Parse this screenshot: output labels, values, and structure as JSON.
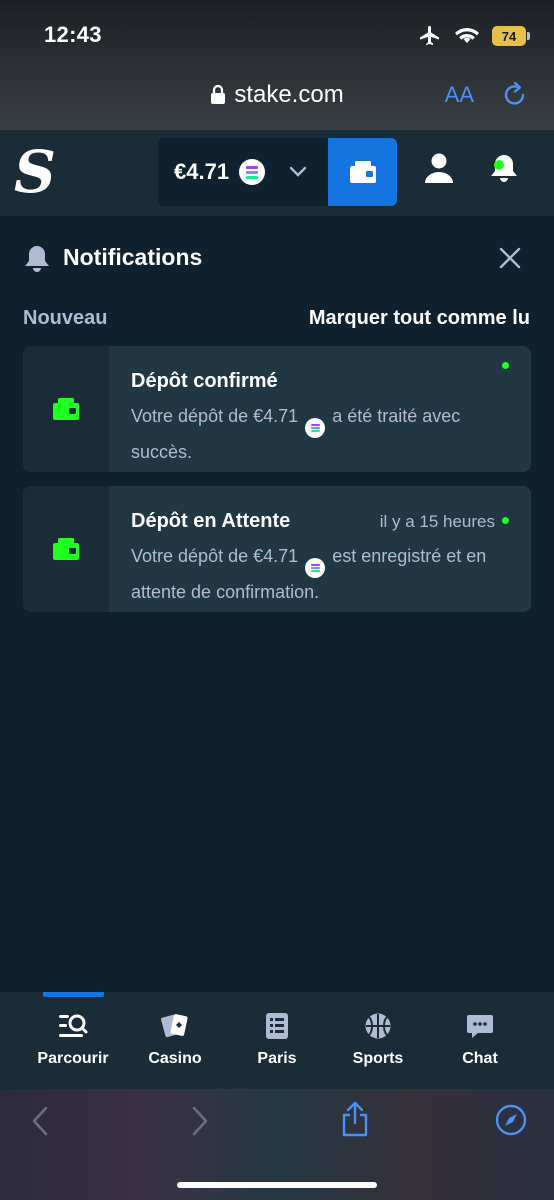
{
  "status_bar": {
    "time": "12:43",
    "battery_level": "74"
  },
  "browser": {
    "url": "stake.com",
    "text_size_label": "AA"
  },
  "header": {
    "logo": "S",
    "balance": "€4.71"
  },
  "notifications": {
    "title": "Notifications",
    "section_label": "Nouveau",
    "mark_all_label": "Marquer tout comme lu",
    "items": [
      {
        "title": "Dépôt confirmé",
        "body_before": "Votre dépôt de €4.71",
        "body_after": "a été traité avec succès.",
        "time_ago": ""
      },
      {
        "title": "Dépôt en Attente",
        "body_before": "Votre dépôt de €4.71",
        "body_after": "est enregistré et en attente de confirmation.",
        "time_ago": "il y a 15 heures"
      }
    ]
  },
  "bottom_nav": {
    "active": "Parcourir",
    "items": [
      {
        "label": "Parcourir",
        "icon": "browse-icon"
      },
      {
        "label": "Casino",
        "icon": "cards-icon"
      },
      {
        "label": "Paris",
        "icon": "betslip-icon"
      },
      {
        "label": "Sports",
        "icon": "basketball-icon"
      },
      {
        "label": "Chat",
        "icon": "chat-icon"
      }
    ]
  },
  "colors": {
    "background": "#0f212e",
    "header": "#1a2c38",
    "card": "#213743",
    "accent_blue": "#1475e1",
    "unread_green": "#1fff20",
    "muted_text": "#b1bad3"
  }
}
